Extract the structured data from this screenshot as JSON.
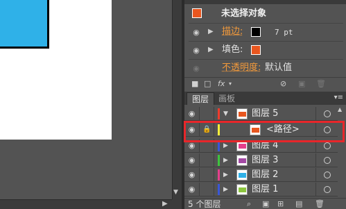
{
  "appearance": {
    "title": "未选择对象",
    "stroke_label": "描边:",
    "stroke_value": "7 pt",
    "fill_label": "填色:",
    "opacity_label": "不透明度:",
    "opacity_value": "默认值",
    "swatch_color": "#e8561f"
  },
  "layers": {
    "tabs": [
      "图层",
      "画板"
    ],
    "rows": [
      {
        "name": "图层 5",
        "color": "#ef3b2c",
        "expanded": true
      },
      {
        "name": "<路径>",
        "color": "#f6ef3c",
        "locked": true
      },
      {
        "name": "图层 4",
        "color": "#3a57d8"
      },
      {
        "name": "图层 3",
        "color": "#3ec43e"
      },
      {
        "name": "图层 2",
        "color": "#2fb1e8"
      },
      {
        "name": "图层 1",
        "color": "#3a57d8"
      }
    ],
    "count_label": "5 个图层"
  },
  "icons": {
    "eye": "eye-icon",
    "lock": "lock-icon",
    "target": "target-circle-icon"
  },
  "colors": {
    "highlight": "#e8262a",
    "canvas_shape": "#2fb1e8"
  }
}
